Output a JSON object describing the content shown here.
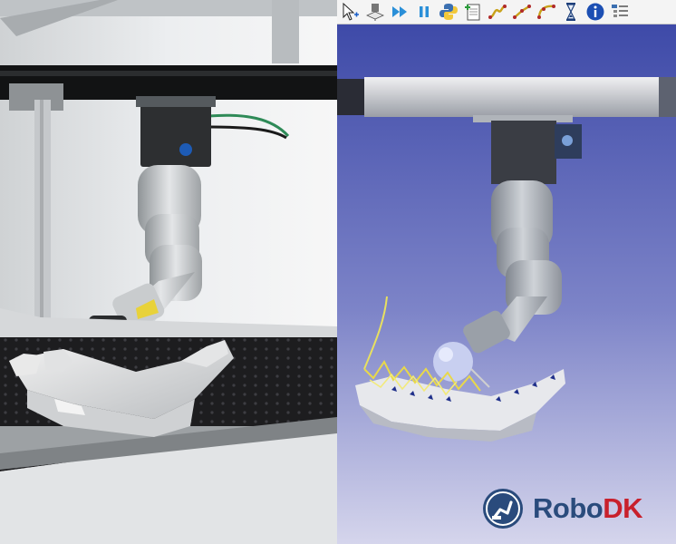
{
  "toolbar": {
    "buttons": [
      {
        "icon": "select-move-icon"
      },
      {
        "icon": "teach-target-icon"
      },
      {
        "icon": "fast-forward-icon"
      },
      {
        "icon": "pause-icon"
      },
      {
        "icon": "python-icon"
      },
      {
        "icon": "add-program-icon"
      },
      {
        "icon": "move-joint-icon"
      },
      {
        "icon": "move-linear-icon"
      },
      {
        "icon": "move-circular-icon"
      },
      {
        "icon": "pause-time-icon"
      },
      {
        "icon": "info-icon"
      },
      {
        "icon": "program-instruction-icon"
      }
    ]
  },
  "logo": {
    "robo": "Robo",
    "dk": "DK"
  },
  "colors": {
    "sim_background_top": "#3e4aa8",
    "sim_background_bottom": "#d5d5ec",
    "robodk_blue": "#2a4b7c",
    "robodk_red": "#c8202c"
  }
}
